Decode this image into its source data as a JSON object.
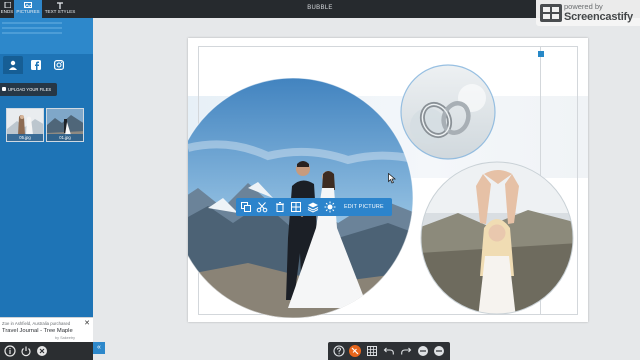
{
  "app": {
    "title": "BUBBLE"
  },
  "top_tabs": [
    {
      "label": "ENDS",
      "icon": "layout-icon"
    },
    {
      "label": "PICTURES",
      "icon": "image-icon",
      "active": true
    },
    {
      "label": "TEXT STYLES",
      "icon": "text-icon"
    }
  ],
  "sidebar": {
    "sub_tabs": [
      {
        "icon": "user-icon",
        "active": true
      },
      {
        "icon": "facebook-icon"
      },
      {
        "icon": "instagram-icon"
      }
    ],
    "upload_label": "UPLOAD YOUR FILES",
    "thumbnails": [
      {
        "caption": "05.jpg"
      },
      {
        "caption": "01.jpg"
      }
    ]
  },
  "notification": {
    "line1": "Zoe in Ashfield, Australia purchased",
    "line2": "Travel Journal - Tree Maple",
    "line3": "by Sakeetry"
  },
  "toolbar": {
    "edit_label": "EDIT PICTURE",
    "icons": [
      "copy-icon",
      "scissors-icon",
      "trash-icon",
      "grid-icon",
      "layers-icon",
      "brightness-icon"
    ]
  },
  "zoom_bar": {
    "icons": [
      "help-icon",
      "no-snap-icon",
      "grid-icon",
      "undo-icon",
      "redo-icon",
      "zoom-out-icon",
      "zoom-in-icon"
    ]
  },
  "watermark": {
    "line1": "powered by",
    "line2": "Screencastify"
  },
  "colors": {
    "accent": "#2c84cc",
    "sidebar": "#1e74b6",
    "topbar": "#262a2e",
    "zoom_active": "#e8661c"
  }
}
